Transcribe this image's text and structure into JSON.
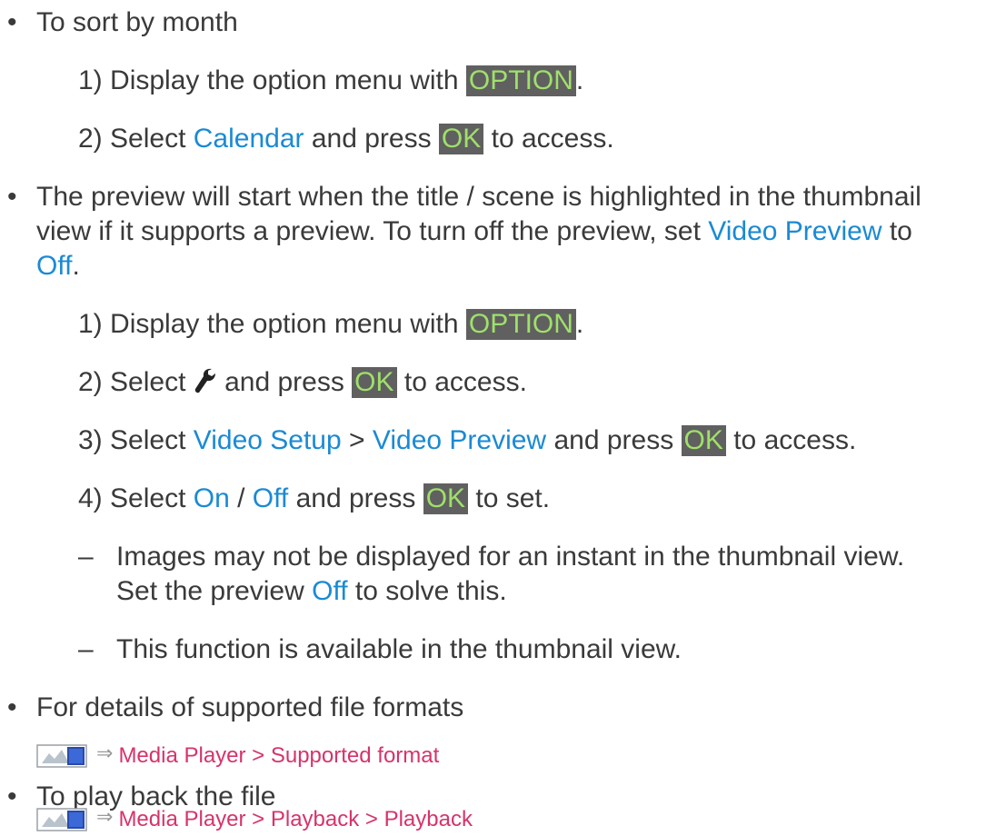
{
  "sort_by_month": {
    "heading": "To sort by month",
    "step1": {
      "num": "1)",
      "pre": "Display the option menu with ",
      "key": "OPTION",
      "post": "."
    },
    "step2": {
      "num": "2)",
      "pre": "Select ",
      "link": "Calendar",
      "mid": " and press ",
      "key": "OK",
      "post": " to access."
    }
  },
  "preview": {
    "line1": "The preview will start when the title / scene is highlighted in the thumbnail",
    "line2_pre": "view if it supports a preview. To turn off the preview, set ",
    "line2_link": "Video Preview",
    "line2_post": " to",
    "line3_link": "Off",
    "line3_post": ".",
    "step1": {
      "num": "1)",
      "pre": "Display the option menu with ",
      "key": "OPTION",
      "post": "."
    },
    "step2": {
      "num": "2)",
      "pre": "Select ",
      "icon": "wrench-icon",
      "mid": " and press ",
      "key": "OK",
      "post": " to access."
    },
    "step3": {
      "num": "3)",
      "pre": "Select ",
      "link1": "Video Setup",
      "sep": " > ",
      "link2": "Video Preview",
      "mid": " and press ",
      "key": "OK",
      "post": " to access."
    },
    "step4": {
      "num": "4)",
      "pre": "Select ",
      "link1": "On",
      "sep": " / ",
      "link2": "Off",
      "mid": " and press ",
      "key": "OK",
      "post": " to set."
    },
    "note1_line1": "Images may not be displayed for an instant in the thumbnail view.",
    "note1_line2_pre": "Set the preview ",
    "note1_line2_link": "Off",
    "note1_line2_post": " to solve this.",
    "note2": "This function is available in the thumbnail view.",
    "dash": "–"
  },
  "formats": {
    "heading": "For details of supported file formats",
    "link": "Media Player > Supported format"
  },
  "playback": {
    "heading": "To play back the file",
    "link": "Media Player > Playback > Playback"
  },
  "bullet": "•",
  "icons": {
    "reference": "tv-reference-icon",
    "arrow": "arrow-right-icon"
  },
  "colors": {
    "link_blue": "#1a8ad4",
    "link_pink": "#d6336c",
    "key_bg": "#606060",
    "key_fg": "#9fe06a"
  }
}
